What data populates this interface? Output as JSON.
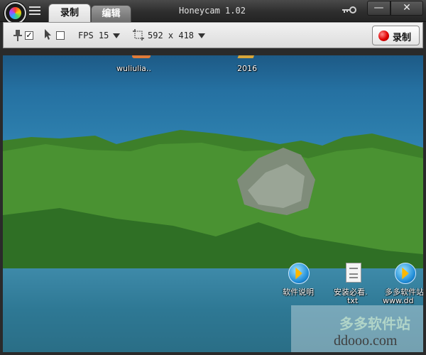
{
  "window": {
    "title": "Honeycam 1.02",
    "tabs": [
      {
        "label": "录制",
        "active": true
      },
      {
        "label": "编辑",
        "active": false
      }
    ]
  },
  "toolbar": {
    "fps_label": "FPS 15",
    "size_label": "592 x 418",
    "pin_checked": true,
    "cursor_checked": false,
    "record_label": "录制"
  },
  "desktop": {
    "icons": [
      {
        "label": "wuliulia..",
        "icon": "apk-file-icon"
      },
      {
        "label": "2016",
        "icon": "folder-icon"
      },
      {
        "label": "软件说明",
        "icon": "app-shortcut-icon"
      },
      {
        "label": "安装必看.",
        "sublabel": "txt",
        "icon": "text-file-icon"
      },
      {
        "label": "多多软件站",
        "sublabel": "www.dd",
        "icon": "app-shortcut-icon"
      }
    ]
  },
  "watermark": {
    "text": "ddooo.com",
    "top_text": "多多软件站"
  },
  "colors": {
    "titlebar": "#2e2e2e",
    "toolbar": "#e6e6e6",
    "record_red": "#e00000"
  }
}
